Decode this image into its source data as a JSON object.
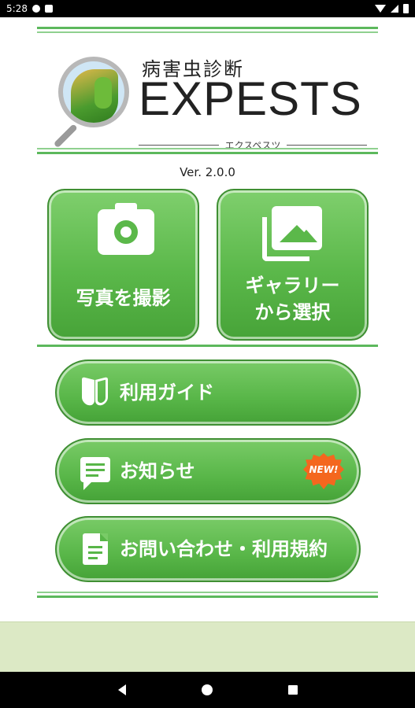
{
  "status_bar": {
    "time": "5:28"
  },
  "logo": {
    "title_jp": "病害虫診断",
    "title_en": "EXPESTS",
    "subtitle": "エクスペスツ"
  },
  "version": "Ver. 2.0.0",
  "tiles": [
    {
      "label_line1": "写真を撮影",
      "icon": "camera-icon"
    },
    {
      "label_line1": "ギャラリー",
      "label_line2": "から選択",
      "icon": "gallery-icon"
    }
  ],
  "menu": [
    {
      "label": "利用ガイド",
      "icon": "beginner-mark-icon"
    },
    {
      "label": "お知らせ",
      "icon": "chat-icon",
      "badge": "NEW!"
    },
    {
      "label": "お問い合わせ・利用規約",
      "icon": "document-icon"
    }
  ],
  "colors": {
    "accent": "#5bb84a",
    "border": "#3f8f33",
    "badge": "#f4671e",
    "footer": "#dce9c5"
  }
}
